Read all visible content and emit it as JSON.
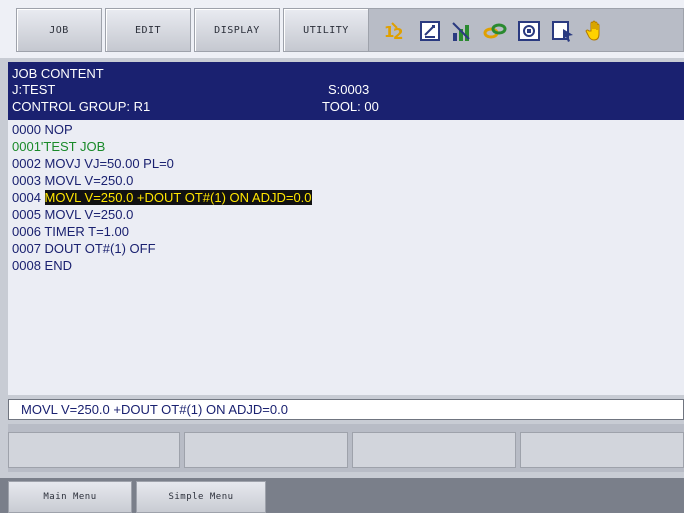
{
  "top_menu": {
    "items": [
      "JOB",
      "EDIT",
      "DISPLAY",
      "UTILITY"
    ]
  },
  "status_icons": [
    "coordinate-1-2-icon",
    "edit-box-icon",
    "signal-bars-icon",
    "link-chain-icon",
    "servo-icon",
    "cursor-mode-icon",
    "hand-icon"
  ],
  "job_content": {
    "title": "JOB CONTENT",
    "job_name": "J:TEST",
    "step": "S:0003",
    "control_group": "CONTROL GROUP: R1",
    "tool": "TOOL: 00",
    "lines": [
      {
        "num": "0000",
        "text": "NOP"
      },
      {
        "num": "0001",
        "text": "'TEST JOB"
      },
      {
        "num": "0002",
        "text": "MOVJ VJ=50.00 PL=0"
      },
      {
        "num": "0003",
        "text": "MOVL V=250.0"
      },
      {
        "num": "0004",
        "text": "MOVL V=250.0 +DOUT OT#(1) ON ADJD=0.0"
      },
      {
        "num": "0005",
        "text": "MOVL V=250.0"
      },
      {
        "num": "0006",
        "text": "TIMER T=1.00"
      },
      {
        "num": "0007",
        "text": "DOUT OT#(1) OFF"
      },
      {
        "num": "0008",
        "text": "END"
      }
    ]
  },
  "edit_buffer": "MOVL V=250.0 +DOUT OT#(1) ON ADJD=0.0",
  "bottom_menu": {
    "main_menu": "Main Menu",
    "simple_menu": "Simple Menu"
  },
  "colors": {
    "header_bg": "#1a2170",
    "code_text": "#1a2170",
    "comment_text": "#1a8a2a",
    "highlight_bg": "#111111",
    "highlight_text": "#ffe600"
  }
}
